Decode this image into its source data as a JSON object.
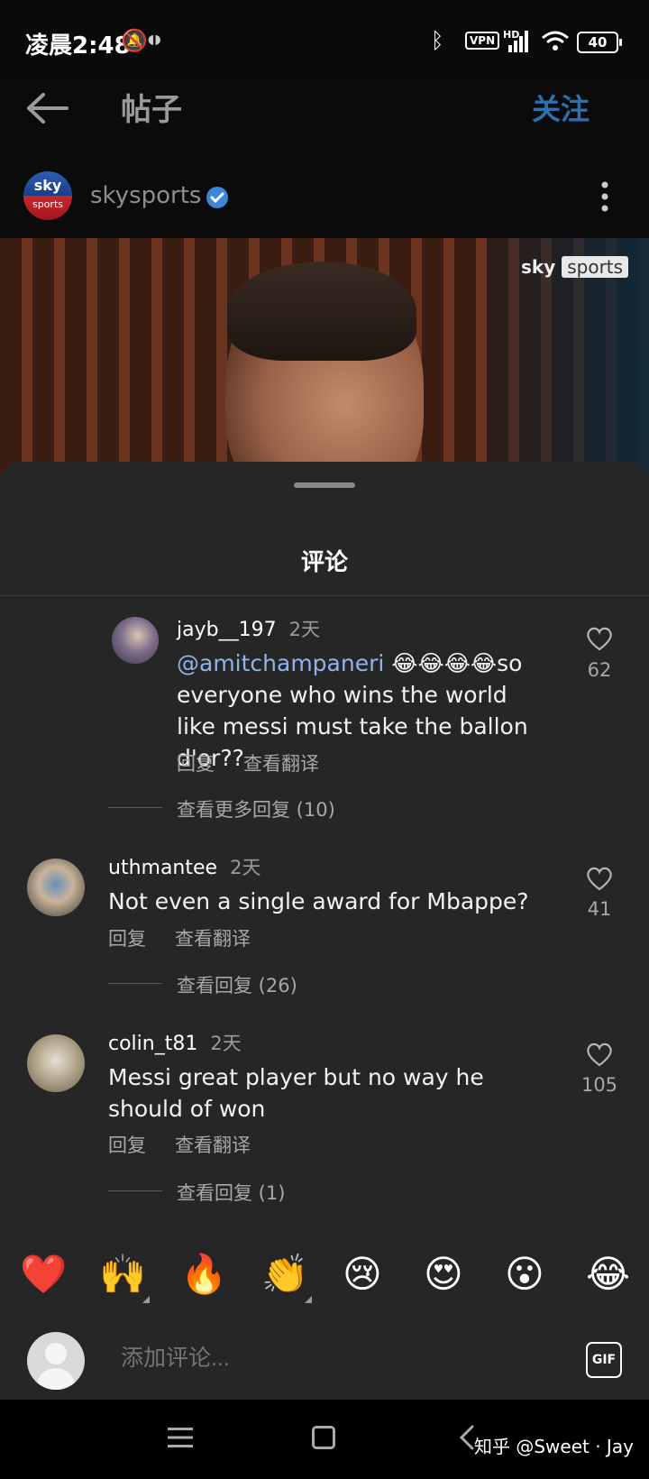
{
  "status_bar": {
    "time": "凌晨2:48",
    "vpn": "VPN",
    "signal_label": "HD",
    "battery": "40"
  },
  "header": {
    "title": "帖子",
    "follow_label": "关注"
  },
  "account": {
    "name": "skysports",
    "avatar_top": "sky",
    "avatar_bottom": "sports",
    "verified": true
  },
  "post": {
    "watermark_brand": "sky",
    "watermark_tag": "sports"
  },
  "sheet": {
    "title": "评论"
  },
  "comments": [
    {
      "username": "jayb__197",
      "time": "2天",
      "mention": "@amitchampaneri",
      "emojis": "😂😂😂😂",
      "text": "so everyone who wins the world like messi must take the ballon d'or??",
      "reply_label": "回复",
      "translate_label": "查看翻译",
      "likes": "62",
      "more_replies": "查看更多回复 (10)"
    },
    {
      "username": "uthmantee",
      "time": "2天",
      "text": "Not even  a single award for Mbappe?",
      "reply_label": "回复",
      "translate_label": "查看翻译",
      "likes": "41",
      "more_replies": "查看回复 (26)"
    },
    {
      "username": "colin_t81",
      "time": "2天",
      "text": "Messi great player but no way he should of won",
      "reply_label": "回复",
      "translate_label": "查看翻译",
      "likes": "105",
      "more_replies": "查看回复 (1)"
    }
  ],
  "emoji_bar": [
    "❤️",
    "🙌",
    "🔥",
    "👏",
    "😢",
    "😍",
    "😮",
    "😂"
  ],
  "input": {
    "placeholder": "添加评论...",
    "gif_label": "GIF"
  },
  "watermark": "知乎 @Sweet · Jay"
}
